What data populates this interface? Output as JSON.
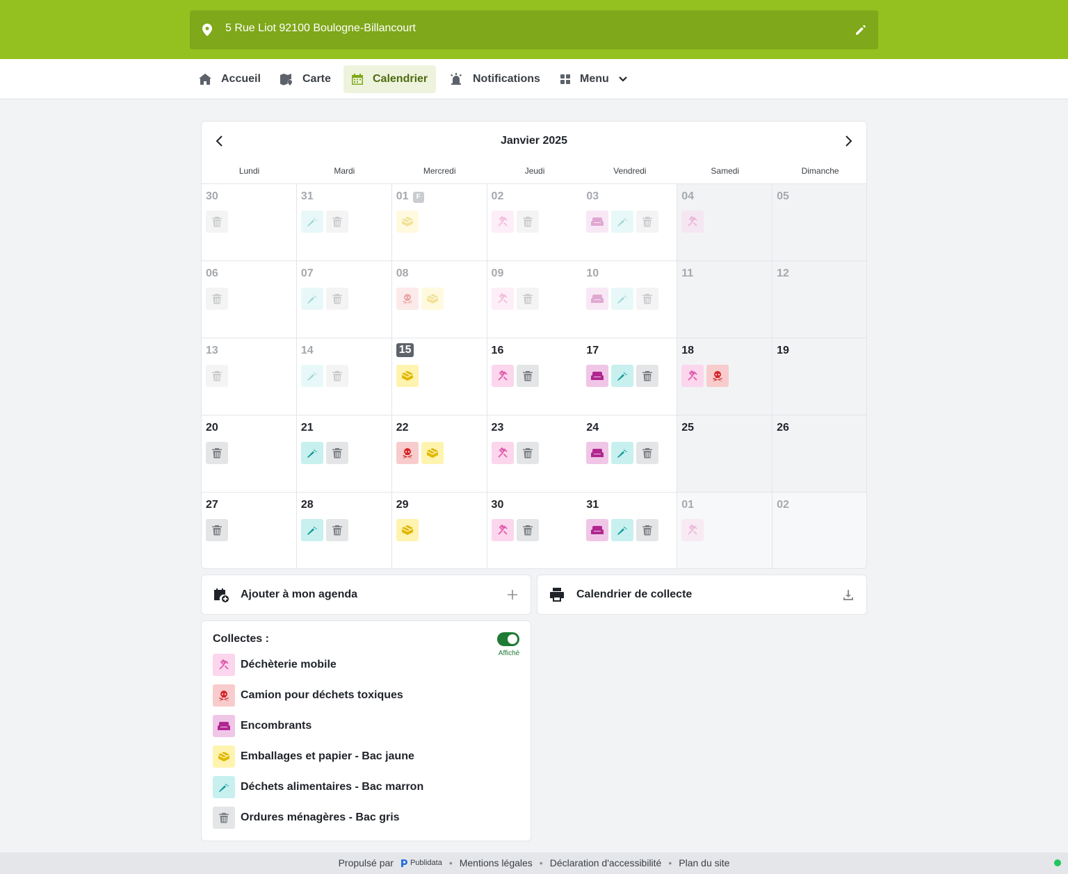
{
  "header": {
    "address": "5 Rue Liot 92100 Boulogne-Billancourt",
    "pin_icon": "map-pin-icon",
    "edit_icon": "pencil-icon"
  },
  "nav": {
    "items": [
      {
        "label": "Accueil",
        "icon": "home-icon"
      },
      {
        "label": "Carte",
        "icon": "map-icon"
      },
      {
        "label": "Calendrier",
        "icon": "calendar-icon",
        "active": true
      },
      {
        "label": "Notifications",
        "icon": "alarm-icon"
      },
      {
        "label": "Menu",
        "icon": "grid-icon"
      }
    ]
  },
  "calendar": {
    "title": "Janvier 2025",
    "weekdays": [
      "Lundi",
      "Mardi",
      "Mercredi",
      "Jeudi",
      "Vendredi",
      "Samedi",
      "Dimanche"
    ],
    "holiday_marker": "F",
    "weeks": [
      [
        {
          "day": "30",
          "icons": [
            "trash"
          ],
          "past": true
        },
        {
          "day": "31",
          "icons": [
            "carrot",
            "trash"
          ],
          "past": true
        },
        {
          "day": "01",
          "icons": [
            "box"
          ],
          "past": true,
          "holiday": true
        },
        {
          "day": "02",
          "icons": [
            "wrench",
            "trash"
          ],
          "past": true
        },
        {
          "day": "03",
          "icons": [
            "sofa",
            "carrot",
            "trash"
          ],
          "past": true
        },
        {
          "day": "04",
          "icons": [
            "wrench"
          ],
          "past": true
        },
        {
          "day": "05",
          "icons": [],
          "past": true
        }
      ],
      [
        {
          "day": "06",
          "icons": [
            "trash"
          ],
          "past": true
        },
        {
          "day": "07",
          "icons": [
            "carrot",
            "trash"
          ],
          "past": true
        },
        {
          "day": "08",
          "icons": [
            "skull",
            "box"
          ],
          "past": true
        },
        {
          "day": "09",
          "icons": [
            "wrench",
            "trash"
          ],
          "past": true
        },
        {
          "day": "10",
          "icons": [
            "sofa",
            "carrot",
            "trash"
          ],
          "past": true
        },
        {
          "day": "11",
          "icons": [],
          "past": true
        },
        {
          "day": "12",
          "icons": [],
          "past": true
        }
      ],
      [
        {
          "day": "13",
          "icons": [
            "trash"
          ],
          "past": true
        },
        {
          "day": "14",
          "icons": [
            "carrot",
            "trash"
          ],
          "past": true
        },
        {
          "day": "15",
          "icons": [
            "box"
          ],
          "today": true
        },
        {
          "day": "16",
          "icons": [
            "wrench",
            "trash"
          ]
        },
        {
          "day": "17",
          "icons": [
            "sofa",
            "carrot",
            "trash"
          ]
        },
        {
          "day": "18",
          "icons": [
            "wrench",
            "skull"
          ]
        },
        {
          "day": "19",
          "icons": []
        }
      ],
      [
        {
          "day": "20",
          "icons": [
            "trash"
          ]
        },
        {
          "day": "21",
          "icons": [
            "carrot",
            "trash"
          ]
        },
        {
          "day": "22",
          "icons": [
            "skull",
            "box"
          ]
        },
        {
          "day": "23",
          "icons": [
            "wrench",
            "trash"
          ]
        },
        {
          "day": "24",
          "icons": [
            "sofa",
            "carrot",
            "trash"
          ]
        },
        {
          "day": "25",
          "icons": []
        },
        {
          "day": "26",
          "icons": []
        }
      ],
      [
        {
          "day": "27",
          "icons": [
            "trash"
          ]
        },
        {
          "day": "28",
          "icons": [
            "carrot",
            "trash"
          ]
        },
        {
          "day": "29",
          "icons": [
            "box"
          ]
        },
        {
          "day": "30",
          "icons": [
            "wrench",
            "trash"
          ]
        },
        {
          "day": "31",
          "icons": [
            "sofa",
            "carrot",
            "trash"
          ]
        },
        {
          "day": "01",
          "icons": [
            "wrench"
          ],
          "outside": true
        },
        {
          "day": "02",
          "icons": [],
          "outside": true
        }
      ]
    ]
  },
  "actions": {
    "agenda_label": "Ajouter à mon agenda",
    "print_label": "Calendrier de collecte"
  },
  "legend": {
    "title": "Collectes :",
    "toggle_label": "Affiché",
    "items": [
      {
        "type": "wrench",
        "label": "Déchèterie mobile"
      },
      {
        "type": "skull",
        "label": "Camion pour déchets toxiques"
      },
      {
        "type": "sofa",
        "label": "Encombrants"
      },
      {
        "type": "box",
        "label": "Emballages et papier - Bac jaune"
      },
      {
        "type": "carrot",
        "label": "Déchets alimentaires - Bac marron"
      },
      {
        "type": "trash",
        "label": "Ordures ménagères - Bac gris"
      }
    ]
  },
  "footer": {
    "powered_by": "Propulsé par",
    "brand": "Publidata",
    "links": [
      "Mentions légales",
      "Déclaration d'accessibilité",
      "Plan du site"
    ]
  },
  "colors": {
    "brand_green": "#94c11f",
    "trash": "#7c7f84",
    "carrot": "#0e9a9a",
    "sofa": "#b0278f",
    "box": "#e0b800",
    "skull": "#d4262a",
    "wrench": "#e05cae"
  }
}
